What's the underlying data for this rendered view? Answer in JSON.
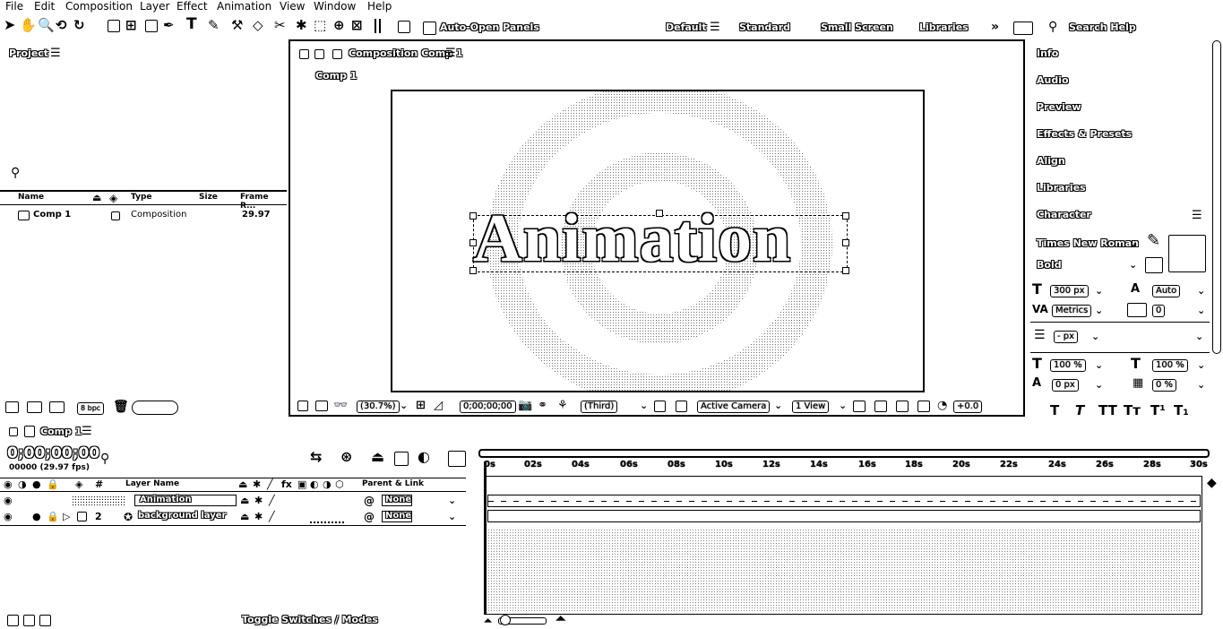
{
  "menu": [
    "File",
    "Edit",
    "Composition",
    "Layer",
    "Effect",
    "Animation",
    "View",
    "Window",
    "Help"
  ],
  "toolbar": {
    "auto_open": "Auto-Open Panels",
    "workspaces": [
      "Default",
      "Standard",
      "Small Screen",
      "Libraries"
    ],
    "search_help": "Search Help"
  },
  "project": {
    "title": "Project",
    "columns": [
      "Name",
      "Type",
      "Size",
      "Frame R..."
    ],
    "row": {
      "name": "Comp 1",
      "type": "Composition",
      "fps": "29.97"
    },
    "bpc": "8 bpc"
  },
  "composition": {
    "panel_title": "Composition Comp 1",
    "tab": "Comp 1",
    "text": "Animation",
    "zoom": "(30.7%)",
    "timecode": "0;00;00;00",
    "resolution": "(Third)",
    "camera": "Active Camera",
    "view": "1 View",
    "exposure": "+0.0"
  },
  "right_panel": {
    "items": [
      "Info",
      "Audio",
      "Preview",
      "Effects & Presets",
      "Align",
      "Libraries",
      "Character"
    ],
    "font_family": "Times New Roman",
    "font_style": "Bold",
    "font_size": "300 px",
    "leading": "Auto",
    "kerning": "Metrics",
    "tracking": "0",
    "stroke": "- px",
    "vscale": "100 %",
    "hscale": "100 %",
    "baseline": "0 px",
    "tsume": "0 %",
    "styles": [
      "T",
      "T",
      "TT",
      "Tт",
      "T¹",
      "T₁"
    ]
  },
  "timeline": {
    "tab": "Comp 1",
    "timecode": "0;00;00;00",
    "frame_info": "00000 (29.97 fps)",
    "col_layer": "Layer Name",
    "col_parent": "Parent & Link",
    "layers": [
      {
        "num": "1",
        "name": "Animation",
        "parent": "None"
      },
      {
        "num": "2",
        "name": "background layer",
        "parent": "None"
      }
    ],
    "ticks": [
      "0s",
      "02s",
      "04s",
      "06s",
      "08s",
      "10s",
      "12s",
      "14s",
      "16s",
      "18s",
      "20s",
      "22s",
      "24s",
      "26s",
      "28s",
      "30s"
    ],
    "toggle": "Toggle Switches / Modes"
  }
}
